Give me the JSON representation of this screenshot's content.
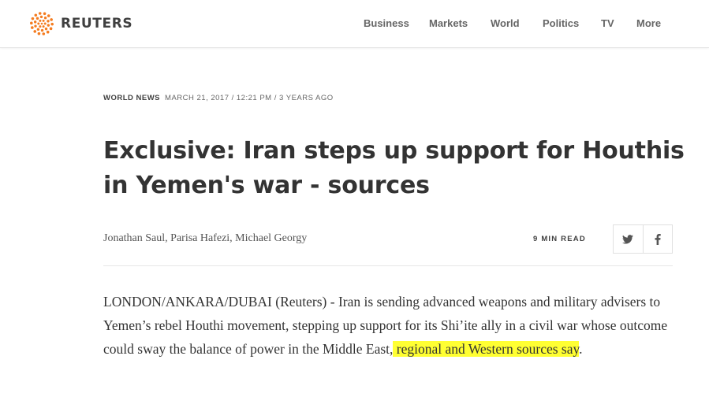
{
  "header": {
    "logo_text": "REUTERS",
    "nav": [
      "Business",
      "Markets",
      "World",
      "Politics",
      "TV",
      "More"
    ]
  },
  "article": {
    "section": "WORLD NEWS",
    "dateline": "MARCH 21, 2017 / 12:21 PM / 3 YEARS AGO",
    "headline": "Exclusive: Iran steps up support for Houthis in Yemen's war - sources",
    "byline": "Jonathan Saul, Parisa Hafezi, Michael Georgy",
    "read_time": "9 MIN READ",
    "share_icons": [
      "twitter-icon",
      "facebook-icon"
    ],
    "lead_plain": "LONDON/ANKARA/DUBAI (Reuters) - Iran is sending advanced weapons and military advisers to Yemen’s rebel Houthi movement, stepping up support for its Shi’ite ally in a civil war whose outcome could sway the balance of power in the Middle East,",
    "lead_highlighted": " regional and Western sources say",
    "lead_end": "."
  },
  "colors": {
    "logo_orange": "#f47c20",
    "highlight": "#ffff33",
    "text": "#333333"
  }
}
